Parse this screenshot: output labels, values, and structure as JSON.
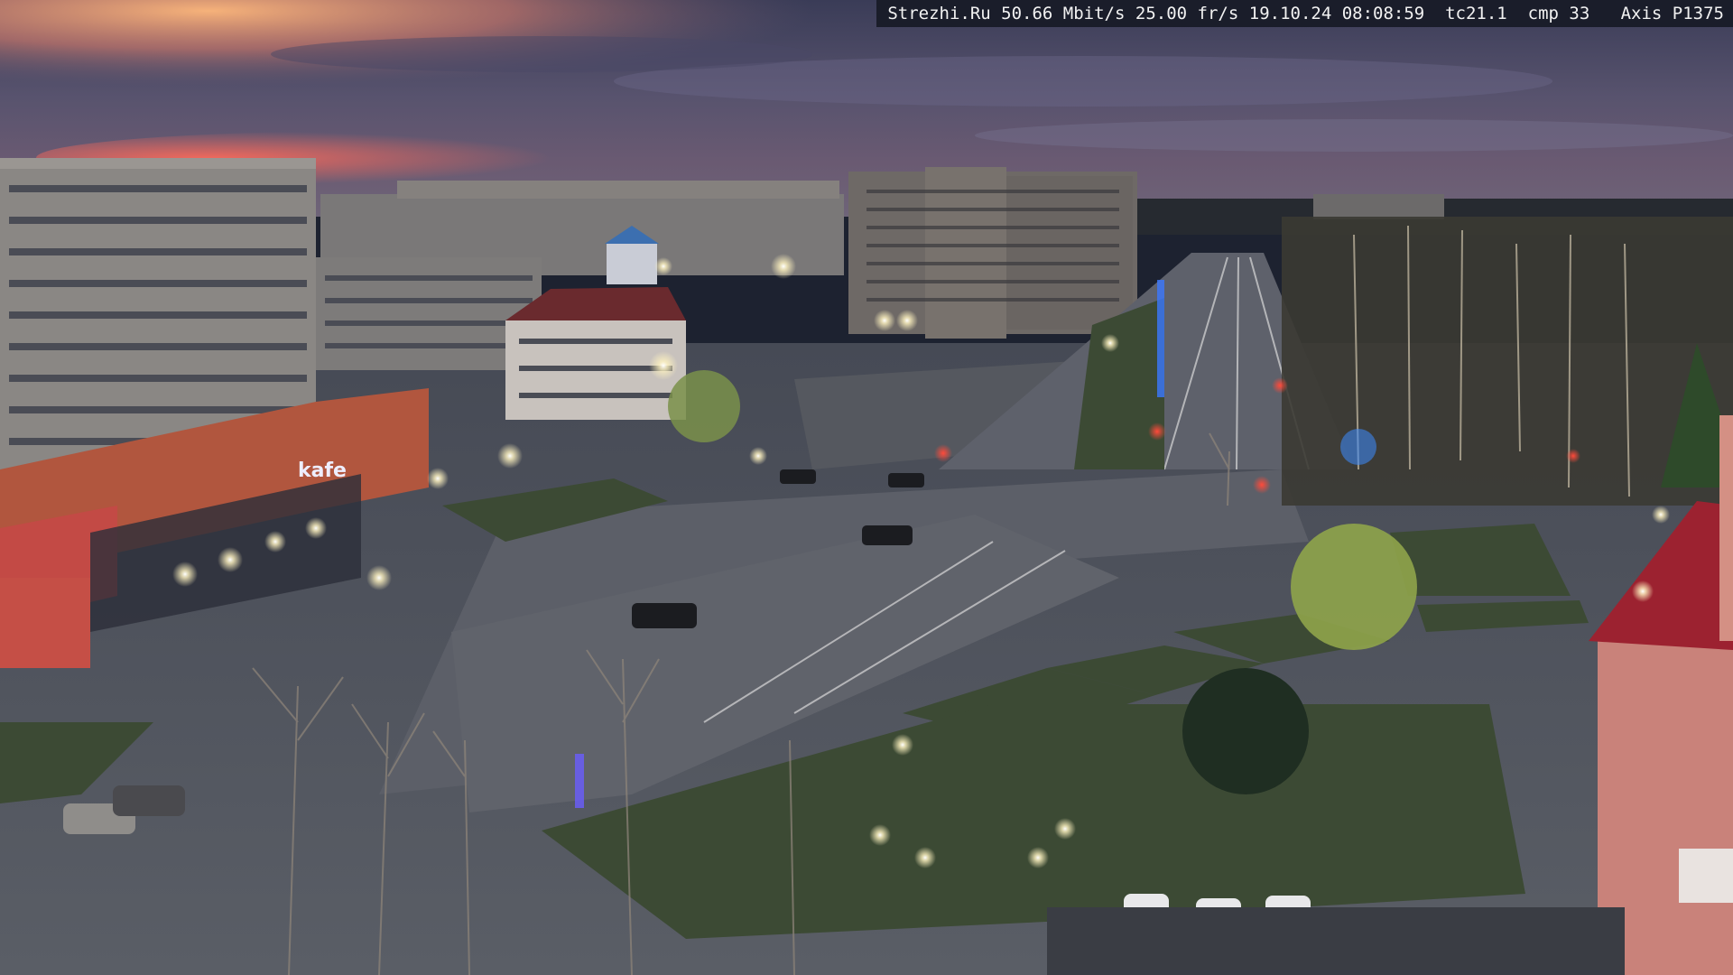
{
  "overlay": {
    "site": "Strezhi.Ru",
    "bitrate": "50.66 Mbit/s",
    "framerate": "25.00 fr/s",
    "datetime": "19.10.24 08:08:59",
    "tc": "tc21.1",
    "cmp": "cmp 33",
    "camera": "Axis P1375"
  },
  "scene": {
    "storefront_sign": "kafe",
    "colors": {
      "sky_top": "#3c3f58",
      "sky_mid": "#5a5570",
      "sky_glow": "#e07a62",
      "sky_orange": "#f3a46a",
      "asphalt": "#4e5460",
      "grass": "#3a4a32",
      "streetlight": "#fff6c8",
      "traffic_red": "#ff2a2a",
      "building_red": "#c24a46"
    }
  }
}
